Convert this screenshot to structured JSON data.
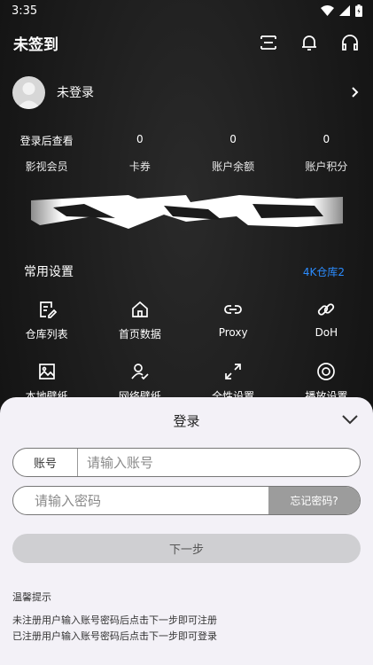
{
  "status_bar": {
    "time": "3:35"
  },
  "header": {
    "title": "未签到"
  },
  "profile": {
    "name": "未登录"
  },
  "stats": [
    {
      "value": "登录后查看",
      "label": "影视会员"
    },
    {
      "value": "0",
      "label": "卡券"
    },
    {
      "value": "0",
      "label": "账户余额"
    },
    {
      "value": "0",
      "label": "账户积分"
    }
  ],
  "settings": {
    "title": "常用设置",
    "link": "4K仓库2",
    "items": [
      {
        "label": "仓库列表",
        "icon": "edit-doc-icon"
      },
      {
        "label": "首页数据",
        "icon": "home-icon"
      },
      {
        "label": "Proxy",
        "icon": "link-icon"
      },
      {
        "label": "DoH",
        "icon": "chain-icon"
      },
      {
        "label": "本地壁纸",
        "icon": "image-icon"
      },
      {
        "label": "网络壁纸",
        "icon": "user-check-icon"
      },
      {
        "label": "全性设置",
        "icon": "expand-icon"
      },
      {
        "label": "播放设置",
        "icon": "play-circle-icon"
      }
    ]
  },
  "login": {
    "title": "登录",
    "account_label": "账号",
    "account_placeholder": "请输入账号",
    "password_placeholder": "请输入密码",
    "forgot": "忘记密码?",
    "next": "下一步",
    "tips_title": "温馨提示",
    "tip1": "未注册用户输入账号密码后点击下一步即可注册",
    "tip2": "已注册用户输入账号密码后点击下一步即可登录"
  }
}
